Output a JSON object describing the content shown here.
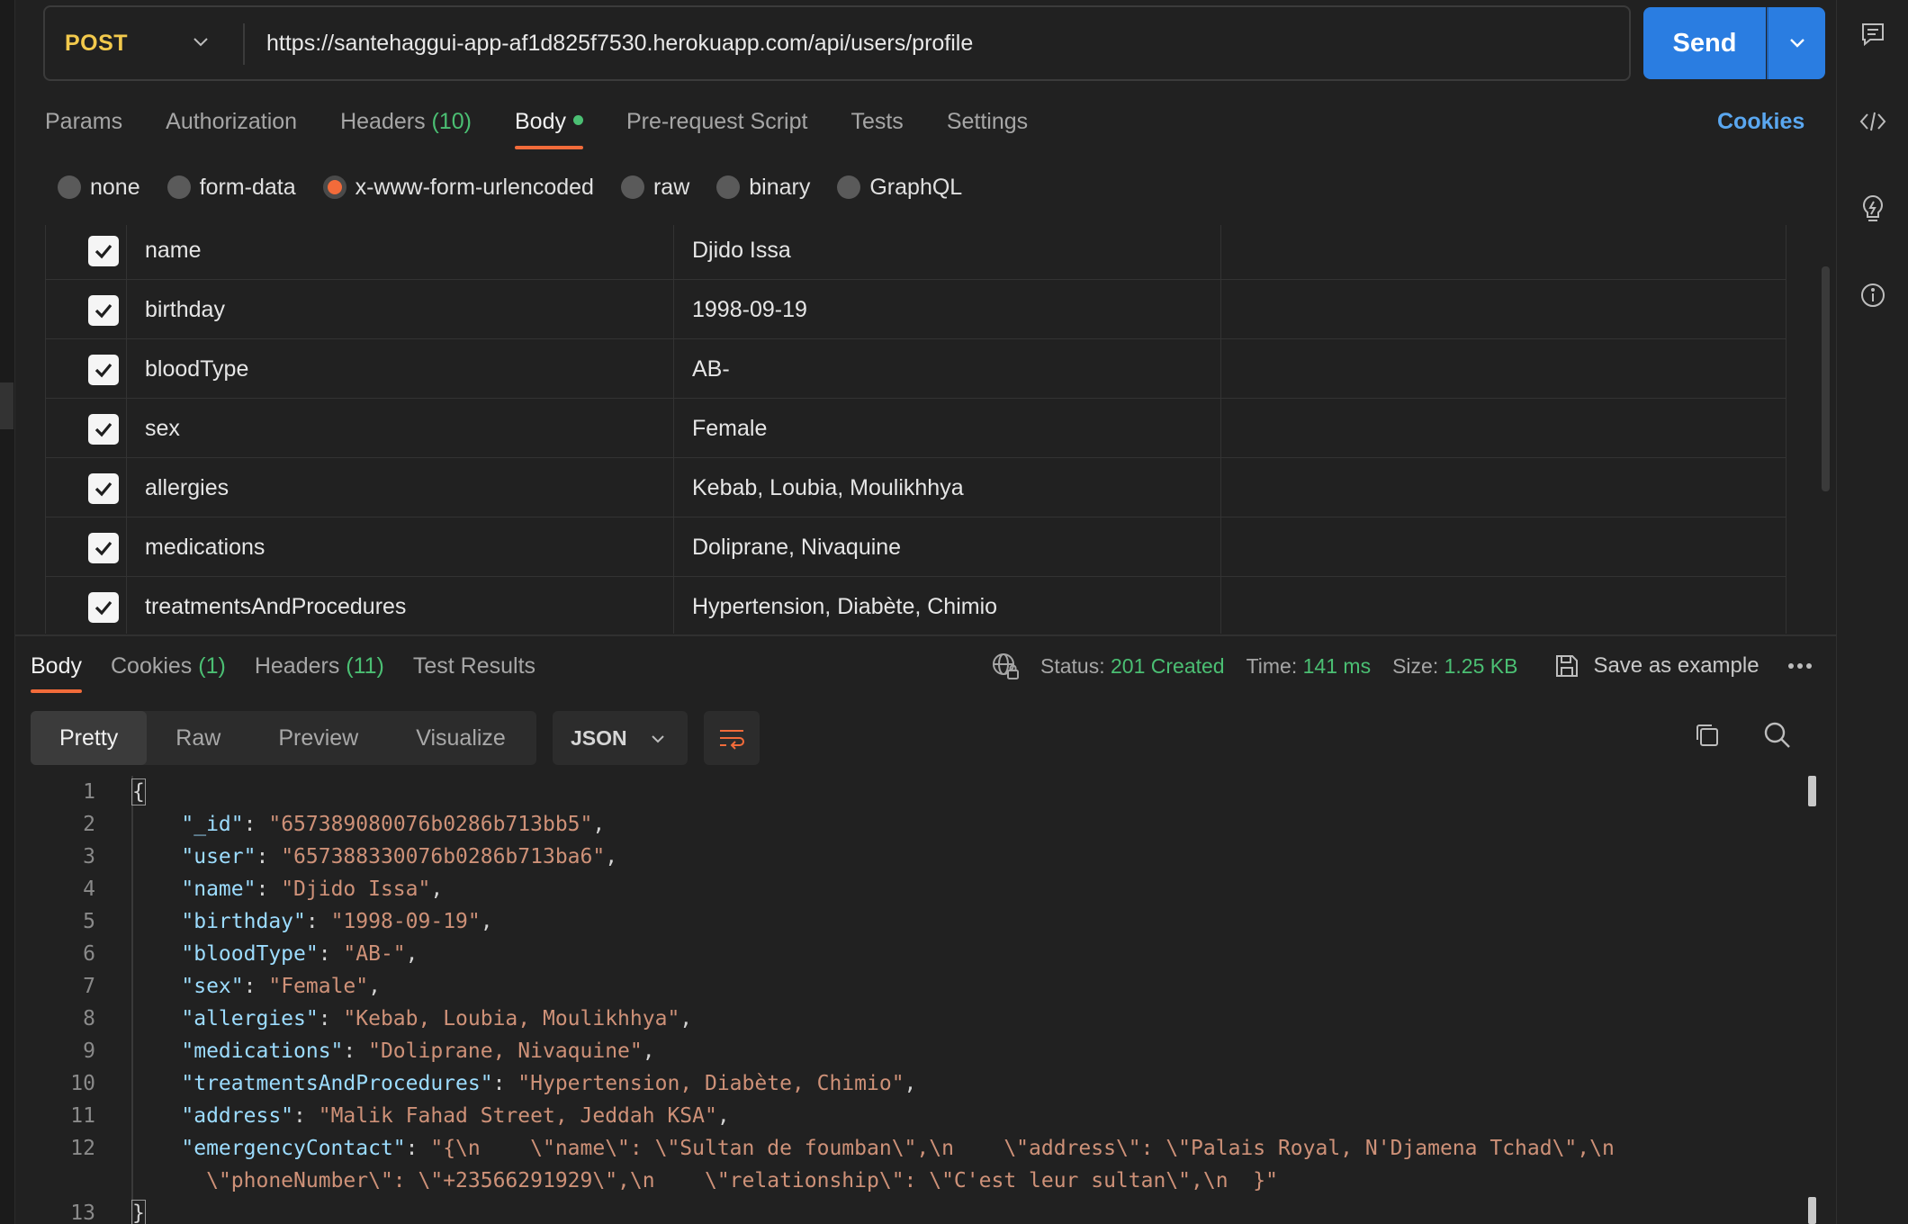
{
  "request": {
    "method": "POST",
    "url": "https://santehaggui-app-af1d825f7530.herokuapp.com/api/users/profile",
    "send_label": "Send"
  },
  "request_tabs": [
    {
      "label": "Params",
      "count": ""
    },
    {
      "label": "Authorization",
      "count": ""
    },
    {
      "label": "Headers",
      "count": "(10)"
    },
    {
      "label": "Body",
      "count": ""
    },
    {
      "label": "Pre-request Script",
      "count": ""
    },
    {
      "label": "Tests",
      "count": ""
    },
    {
      "label": "Settings",
      "count": ""
    }
  ],
  "cookies_link": "Cookies",
  "body_types": [
    "none",
    "form-data",
    "x-www-form-urlencoded",
    "raw",
    "binary",
    "GraphQL"
  ],
  "selected_body_type": "x-www-form-urlencoded",
  "form_rows": [
    {
      "key": "name",
      "value": "Djido Issa",
      "checked": true
    },
    {
      "key": "birthday",
      "value": "1998-09-19",
      "checked": true
    },
    {
      "key": "bloodType",
      "value": "AB-",
      "checked": true
    },
    {
      "key": "sex",
      "value": "Female",
      "checked": true
    },
    {
      "key": "allergies",
      "value": "Kebab, Loubia, Moulikhhya",
      "checked": true
    },
    {
      "key": "medications",
      "value": "Doliprane, Nivaquine",
      "checked": true
    },
    {
      "key": "treatmentsAndProcedures",
      "value": "Hypertension, Diabète, Chimio",
      "checked": true
    }
  ],
  "response": {
    "tabs": [
      {
        "label": "Body",
        "count": ""
      },
      {
        "label": "Cookies",
        "count": "(1)"
      },
      {
        "label": "Headers",
        "count": "(11)"
      },
      {
        "label": "Test Results",
        "count": ""
      }
    ],
    "status_label": "Status:",
    "status_value": "201 Created",
    "time_label": "Time:",
    "time_value": "141 ms",
    "size_label": "Size:",
    "size_value": "1.25 KB",
    "save_example": "Save as example",
    "views": [
      "Pretty",
      "Raw",
      "Preview",
      "Visualize"
    ],
    "active_view": "Pretty",
    "format": "JSON"
  },
  "code_lines": [
    {
      "n": "1"
    },
    {
      "n": "2",
      "key": "\"_id\"",
      "val": "\"657389080076b0286b713bb5\""
    },
    {
      "n": "3",
      "key": "\"user\"",
      "val": "\"657388330076b0286b713ba6\""
    },
    {
      "n": "4",
      "key": "\"name\"",
      "val": "\"Djido Issa\""
    },
    {
      "n": "5",
      "key": "\"birthday\"",
      "val": "\"1998-09-19\""
    },
    {
      "n": "6",
      "key": "\"bloodType\"",
      "val": "\"AB-\""
    },
    {
      "n": "7",
      "key": "\"sex\"",
      "val": "\"Female\""
    },
    {
      "n": "8",
      "key": "\"allergies\"",
      "val": "\"Kebab, Loubia, Moulikhhya\""
    },
    {
      "n": "9",
      "key": "\"medications\"",
      "val": "\"Doliprane, Nivaquine\""
    },
    {
      "n": "10",
      "key": "\"treatmentsAndProcedures\"",
      "val": "\"Hypertension, Diabète, Chimio\""
    },
    {
      "n": "11",
      "key": "\"address\"",
      "val": "\"Malik Fahad Street, Jeddah KSA\""
    },
    {
      "n": "12",
      "key": "\"emergencyContact\"",
      "val": "\"{\\n    \\\"name\\\": \\\"Sultan de foumban\\\",\\n    \\\"address\\\": \\\"Palais Royal, N'Djamena Tchad\\\",\\n",
      "cont": "\\\"phoneNumber\\\": \\\"+23566291929\\\",\\n    \\\"relationship\\\": \\\"C'est leur sultan\\\",\\n  }\""
    },
    {
      "n": "13"
    }
  ],
  "icons": {
    "comment": "comment-icon",
    "code": "code-icon",
    "bulb": "lightbulb-icon",
    "info": "info-icon"
  },
  "colors": {
    "accent_orange": "#f26b3a",
    "send_blue": "#2a7de1",
    "status_green": "#4bbf73",
    "method_yellow": "#f2c94c"
  }
}
